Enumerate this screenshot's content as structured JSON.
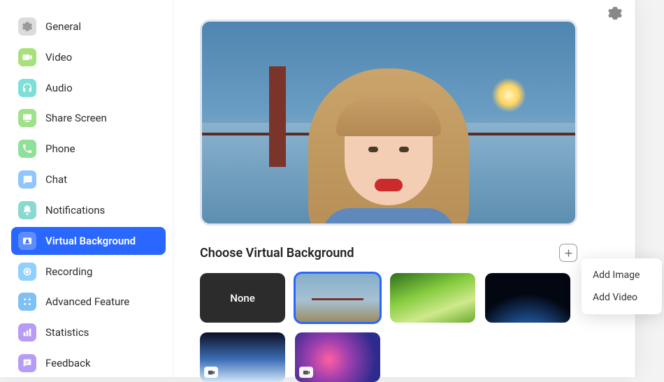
{
  "sidebar": {
    "items": [
      {
        "label": "General",
        "icon": "gear-icon",
        "color": "#dcdcdc",
        "glyph": "#9a9a9a"
      },
      {
        "label": "Video",
        "icon": "video-icon",
        "color": "#a8e07a",
        "glyph": "#ffffff"
      },
      {
        "label": "Audio",
        "icon": "headphones-icon",
        "color": "#7de0d7",
        "glyph": "#ffffff"
      },
      {
        "label": "Share Screen",
        "icon": "share-screen-icon",
        "color": "#9fe08a",
        "glyph": "#ffffff"
      },
      {
        "label": "Phone",
        "icon": "phone-icon",
        "color": "#8fe09a",
        "glyph": "#ffffff"
      },
      {
        "label": "Chat",
        "icon": "chat-icon",
        "color": "#8fc6ff",
        "glyph": "#ffffff"
      },
      {
        "label": "Notifications",
        "icon": "bell-icon",
        "color": "#89d9d0",
        "glyph": "#ffffff"
      },
      {
        "label": "Virtual Background",
        "icon": "vb-icon",
        "color": "#ffffff",
        "glyph": "#ffffff"
      },
      {
        "label": "Recording",
        "icon": "record-icon",
        "color": "#8fd0ff",
        "glyph": "#ffffff"
      },
      {
        "label": "Advanced Feature",
        "icon": "advanced-icon",
        "color": "#7fc0f5",
        "glyph": "#ffffff"
      },
      {
        "label": "Statistics",
        "icon": "stats-icon",
        "color": "#b79cf5",
        "glyph": "#ffffff"
      },
      {
        "label": "Feedback",
        "icon": "feedback-icon",
        "color": "#b79cf5",
        "glyph": "#ffffff"
      }
    ],
    "active_index": 7
  },
  "main": {
    "section_title": "Choose Virtual Background",
    "thumbs": [
      {
        "kind": "none",
        "label": "None"
      },
      {
        "kind": "image",
        "name": "golden-gate",
        "selected": true
      },
      {
        "kind": "image",
        "name": "grass"
      },
      {
        "kind": "image",
        "name": "earth-night"
      },
      {
        "kind": "video",
        "name": "earth-horizon"
      },
      {
        "kind": "video",
        "name": "color-blur"
      }
    ]
  },
  "add_menu": {
    "items": [
      "Add Image",
      "Add Video"
    ]
  }
}
